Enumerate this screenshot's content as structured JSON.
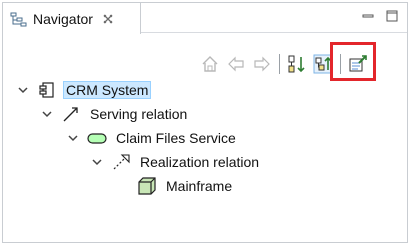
{
  "tab": {
    "title": "Navigator",
    "icon": "navigator-view-icon",
    "close_icon": "close-icon"
  },
  "window_controls": [
    {
      "name": "minimize-icon"
    },
    {
      "name": "maximize-icon"
    }
  ],
  "toolbar": {
    "buttons": [
      {
        "name": "home-icon",
        "enabled": false
      },
      {
        "name": "back-arrow-icon",
        "enabled": false
      },
      {
        "name": "forward-arrow-icon",
        "enabled": false
      },
      {
        "name": "show-incoming-relations-icon",
        "enabled": true
      },
      {
        "name": "show-outgoing-relations-icon",
        "enabled": true,
        "highlighted": true
      },
      {
        "name": "link-to-editor-icon",
        "enabled": true
      }
    ],
    "highlight_color": "#e3262b"
  },
  "tree": {
    "items": [
      {
        "label": "CRM System",
        "icon": "application-component-icon",
        "expanded": true,
        "selected": true
      },
      {
        "label": "Serving relation",
        "icon": "serving-relation-icon",
        "expanded": true
      },
      {
        "label": "Claim Files Service",
        "icon": "application-service-icon",
        "expanded": true
      },
      {
        "label": "Realization relation",
        "icon": "realization-relation-icon",
        "expanded": true
      },
      {
        "label": "Mainframe",
        "icon": "node-icon",
        "expanded": null
      }
    ]
  },
  "colors": {
    "selection_bg": "#cce8ff",
    "selection_border": "#99d1ff",
    "service_fill": "#b5ffb5",
    "node_fill": "#c9e7b7"
  }
}
